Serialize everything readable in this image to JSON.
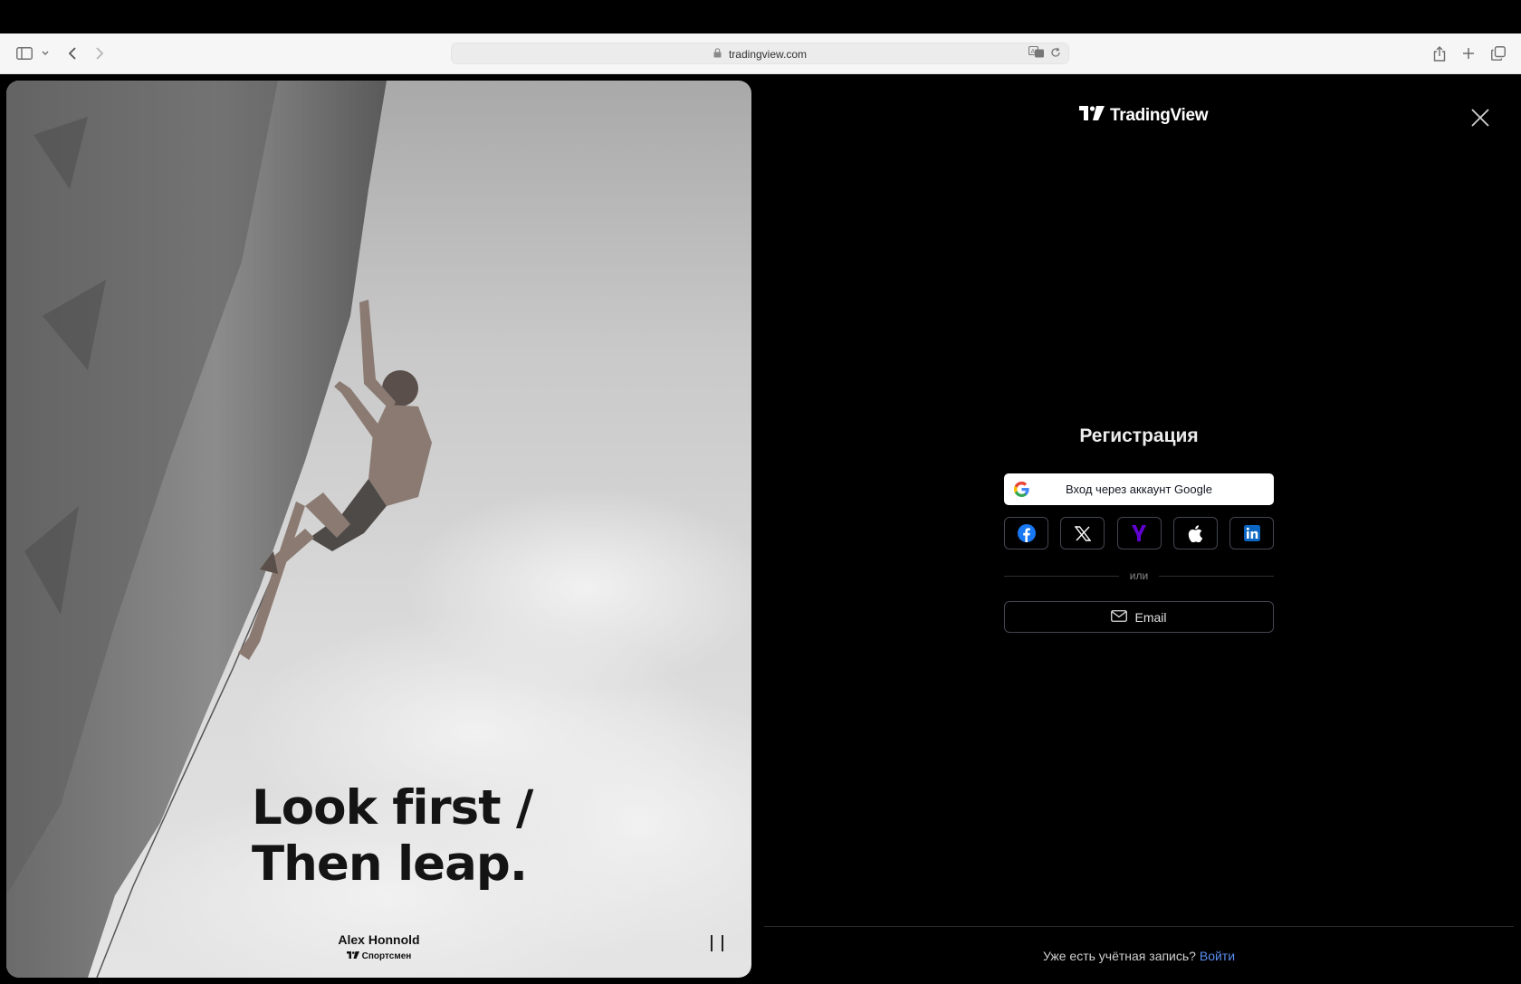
{
  "browser": {
    "url": "tradingview.com"
  },
  "hero": {
    "headline_line1": "Look first /",
    "headline_line2": "Then leap.",
    "athlete_name": "Alex Honnold",
    "athlete_role": "Спортсмен"
  },
  "brand": {
    "name": "TradingView"
  },
  "signup": {
    "title": "Регистрация",
    "google_label": "Вход через аккаунт Google",
    "socials": [
      "facebook",
      "x",
      "yahoo",
      "apple",
      "linkedin"
    ],
    "divider_text": "или",
    "email_label": "Email"
  },
  "footer": {
    "prompt": "Уже есть учётная запись?",
    "signin_link": "Войти"
  },
  "colors": {
    "background": "#000000",
    "link": "#5b8def",
    "facebook": "#1877f2",
    "yahoo": "#6001d2",
    "linkedin": "#0a66c2"
  }
}
